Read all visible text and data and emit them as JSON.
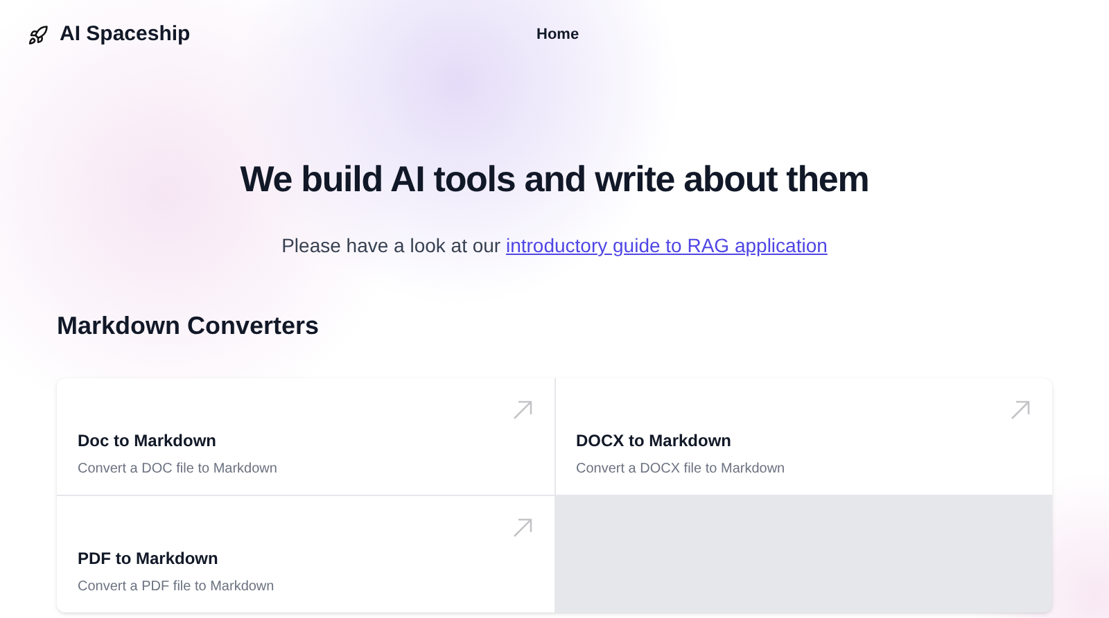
{
  "header": {
    "brand": "AI Spaceship",
    "nav": [
      {
        "label": "Home"
      }
    ]
  },
  "hero": {
    "title": "We build AI tools and write about them",
    "lead": "Please have a look at our",
    "link": "introductory guide to RAG application"
  },
  "section": {
    "title": "Markdown Converters",
    "cards": [
      {
        "title": "Doc to Markdown",
        "description": "Convert a DOC file to Markdown"
      },
      {
        "title": "DOCX to Markdown",
        "description": "Convert a DOCX file to Markdown"
      },
      {
        "title": "PDF to Markdown",
        "description": "Convert a PDF file to Markdown"
      }
    ]
  }
}
